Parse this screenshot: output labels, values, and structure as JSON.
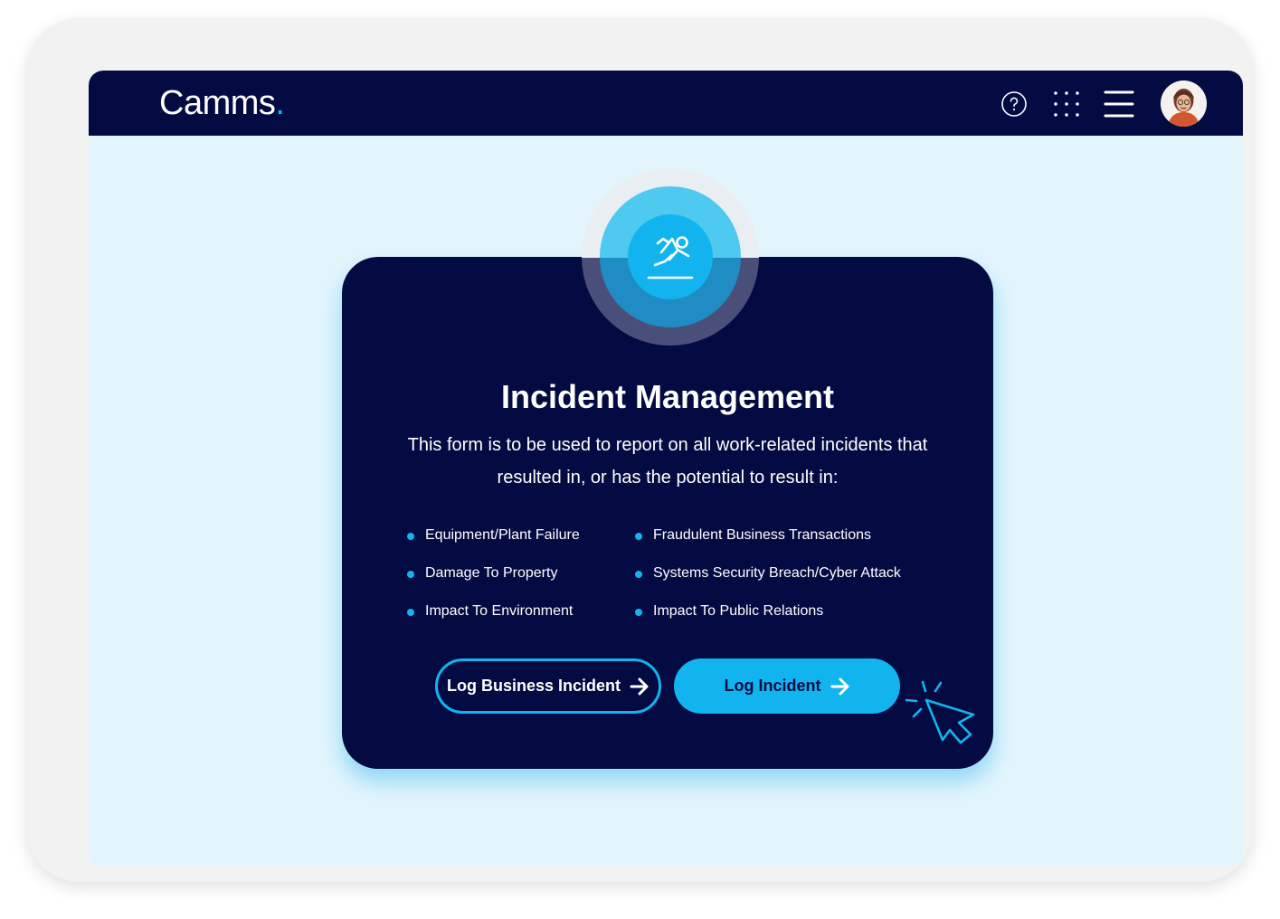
{
  "header": {
    "brand_name": "Camms",
    "brand_dot": ".",
    "icons": [
      "help-icon",
      "apps-grid-icon",
      "hamburger-menu-icon",
      "avatar"
    ]
  },
  "card": {
    "badge_icon": "falling-person-icon",
    "title": "Incident Management",
    "description": "This form is to be used to report on all work-related incidents that resulted in, or has the potential to result in:",
    "items": [
      "Equipment/Plant Failure",
      "Damage To Property",
      "Impact To Environment",
      "Fraudulent Business Transactions",
      "Systems Security Breach/Cyber Attack",
      "Impact To Public Relations"
    ],
    "buttons": {
      "log_business_incident": "Log Business Incident",
      "log_incident": "Log Incident"
    }
  },
  "colors": {
    "navy": "#030b42",
    "accent": "#12b4ef",
    "background": "#e3f5fc"
  }
}
